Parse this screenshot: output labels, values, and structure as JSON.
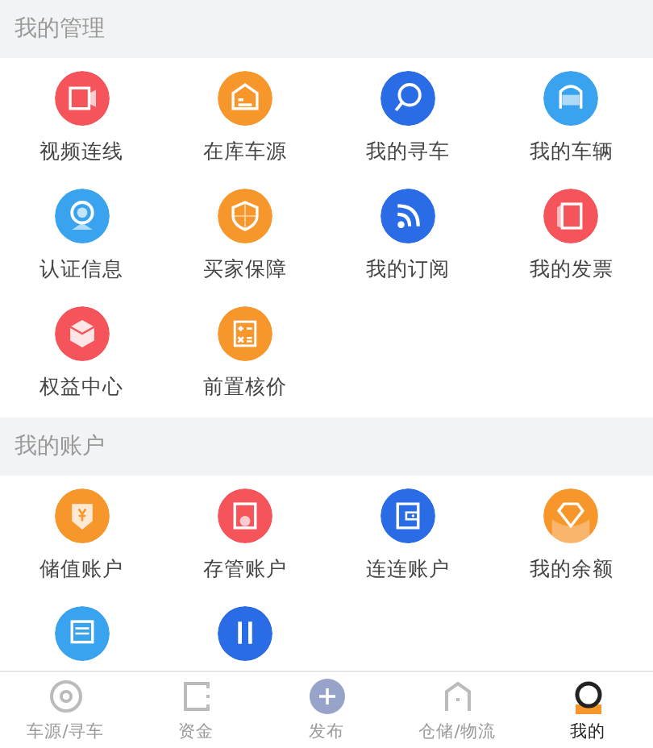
{
  "sections": [
    {
      "title": "我的管理",
      "items": [
        {
          "label": "视频连线",
          "color": "#f5545a"
        },
        {
          "label": "在库车源",
          "color": "#f7962b"
        },
        {
          "label": "我的寻车",
          "color": "#2a6be6"
        },
        {
          "label": "我的车辆",
          "color": "#3aa3f0"
        },
        {
          "label": "认证信息",
          "color": "#3aa3f0"
        },
        {
          "label": "买家保障",
          "color": "#f7962b"
        },
        {
          "label": "我的订阅",
          "color": "#2a6be6"
        },
        {
          "label": "我的发票",
          "color": "#f5545a"
        },
        {
          "label": "权益中心",
          "color": "#f5545a"
        },
        {
          "label": "前置核价",
          "color": "#f7962b"
        }
      ]
    },
    {
      "title": "我的账户",
      "items": [
        {
          "label": "储值账户",
          "color": "#f7962b"
        },
        {
          "label": "存管账户",
          "color": "#f5545a"
        },
        {
          "label": "连连账户",
          "color": "#2a6be6"
        },
        {
          "label": "我的余额",
          "color": "#f7962b"
        },
        {
          "color": "#3aa3f0"
        },
        {
          "color": "#2a6be6"
        }
      ]
    }
  ],
  "tab_bar": [
    {
      "label": "车源/寻车",
      "selected": false
    },
    {
      "label": "资金",
      "selected": false
    },
    {
      "label": "发布",
      "selected": false
    },
    {
      "label": "仓储/物流",
      "selected": false
    },
    {
      "label": "我的",
      "selected": true
    }
  ]
}
